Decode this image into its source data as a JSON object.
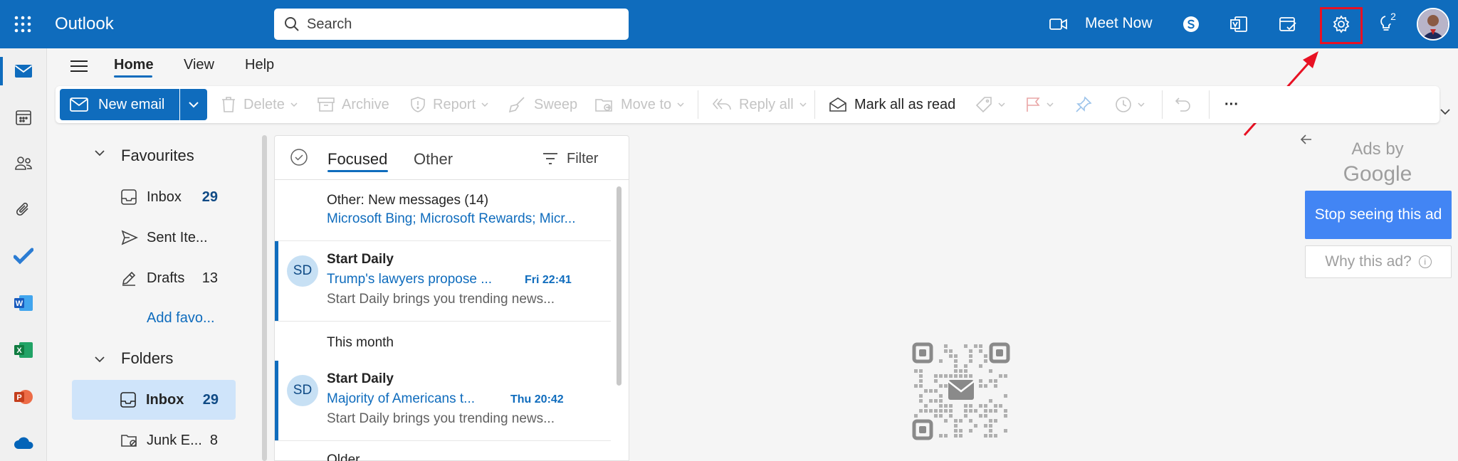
{
  "app": {
    "title": "Outlook"
  },
  "search": {
    "placeholder": "Search"
  },
  "topbar": {
    "meet_now_label": "Meet Now",
    "tips_badge": "2"
  },
  "menu": {
    "tabs": [
      "Home",
      "View",
      "Help"
    ]
  },
  "ribbon": {
    "new_email": "New email",
    "delete": "Delete",
    "archive": "Archive",
    "report": "Report",
    "sweep": "Sweep",
    "move_to": "Move to",
    "reply_all": "Reply all",
    "mark_all_read": "Mark all as read",
    "more": "···"
  },
  "folders": {
    "favourites_header": "Favourites",
    "favourites": [
      {
        "label": "Inbox",
        "count": "29"
      },
      {
        "label": "Sent Ite...",
        "count": ""
      },
      {
        "label": "Drafts",
        "count": "13"
      }
    ],
    "add_favourite": "Add favo...",
    "folders_header": "Folders",
    "items": [
      {
        "label": "Inbox",
        "count": "29"
      },
      {
        "label": "Junk E...",
        "count": "8"
      }
    ]
  },
  "message_list": {
    "tabs": {
      "focused": "Focused",
      "other": "Other"
    },
    "filter_label": "Filter",
    "other_summary": {
      "title": "Other: New messages (14)",
      "senders": "Microsoft Bing; Microsoft Rewards; Micr..."
    },
    "group_this_month": "This month",
    "group_older": "Older",
    "messages": [
      {
        "initials": "SD",
        "sender": "Start Daily",
        "subject": "Trump's lawyers propose ...",
        "time": "Fri 22:41",
        "preview": "Start Daily brings you trending news..."
      },
      {
        "initials": "SD",
        "sender": "Start Daily",
        "subject": "Majority of Americans t...",
        "time": "Thu 20:42",
        "preview": "Start Daily brings you trending news..."
      }
    ]
  },
  "ads": {
    "ads_by": "Ads by",
    "google": "Google",
    "stop_seeing": "Stop seeing this ad",
    "why_this_ad": "Why this ad?",
    "info_glyph": "i"
  },
  "colors": {
    "brand": "#0f6cbd",
    "highlight": "#e81123",
    "ad_button": "#4285f4"
  }
}
